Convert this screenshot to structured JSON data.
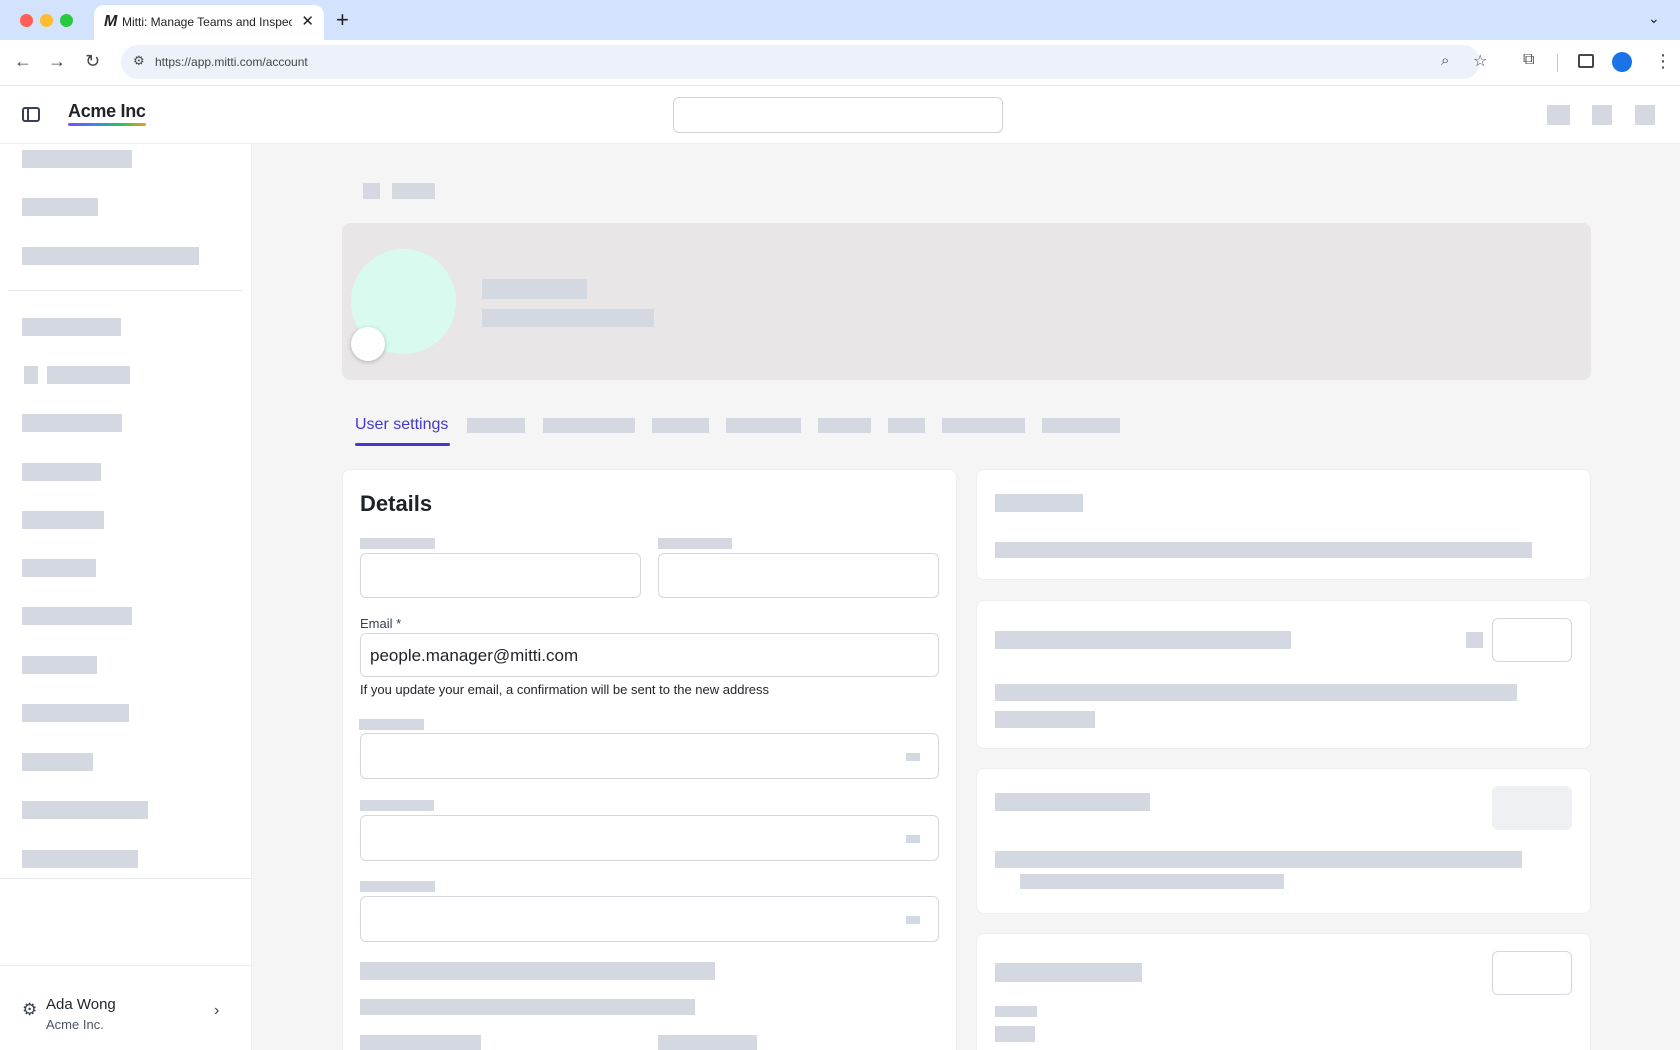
{
  "browser": {
    "tab_title": "Mitti: Manage Teams and Inspect...",
    "favicon_letter": "M",
    "url": "https://app.mitti.com/account",
    "new_tab_symbol": "+",
    "close_symbol": "✕"
  },
  "header": {
    "brand": "Acme Inc"
  },
  "tabs": {
    "active_label": "User settings"
  },
  "details": {
    "title": "Details",
    "email_label": "Email *",
    "email_value": "people.manager@mitti.com",
    "email_hint": "If you update your email, a confirmation will be sent to the new address"
  },
  "user": {
    "name": "Ada Wong",
    "org": "Acme Inc."
  },
  "icons": {
    "back": "back-arrow-icon",
    "forward": "forward-arrow-icon",
    "reload": "reload-icon",
    "settings": "gear-icon",
    "chevron": "chevron-right-icon"
  },
  "colors": {
    "accent": "#4338ca",
    "avatar": "#d9fbef",
    "skeleton": "#d4d8e1",
    "profile_banner": "#e8e6e7"
  }
}
